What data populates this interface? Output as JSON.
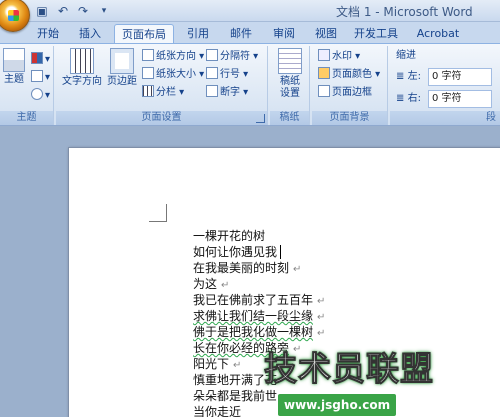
{
  "window": {
    "title": "文档 1 - Microsoft Word"
  },
  "quick_access": {
    "save_icon": "save-icon",
    "undo_icon": "undo-icon",
    "redo_icon": "redo-icon",
    "customize_icon": "customize-icon"
  },
  "tabs": [
    {
      "label": "开始"
    },
    {
      "label": "插入"
    },
    {
      "label": "页面布局",
      "active": true
    },
    {
      "label": "引用"
    },
    {
      "label": "邮件"
    },
    {
      "label": "审阅"
    },
    {
      "label": "视图"
    },
    {
      "label": "开发工具"
    },
    {
      "label": "Acrobat"
    }
  ],
  "ribbon": {
    "theme_group": {
      "label": "主题",
      "themes_button": "主题",
      "colors_icon": "theme-colors-icon",
      "fonts_icon": "theme-fonts-icon",
      "effects_icon": "theme-effects-icon"
    },
    "page_setup": {
      "label": "页面设置",
      "text_direction": "文字方向",
      "margins": "页边距",
      "orientation": "纸张方向",
      "size": "纸张大小",
      "columns": "分栏",
      "breaks": "分隔符",
      "line_numbers": "行号",
      "hyphenation": "断字"
    },
    "draft": {
      "label": "稿纸",
      "button": "稿纸\n设置"
    },
    "page_background": {
      "label": "页面背景",
      "watermark": "水印",
      "page_color": "页面颜色",
      "page_borders": "页面边框"
    },
    "paragraph": {
      "label": "段",
      "indent_title": "缩进",
      "left_label": "左:",
      "left_value": "0 字符",
      "right_label": "右:",
      "right_value": "0 字符"
    }
  },
  "document": {
    "lines": [
      "一棵开花的树",
      "如何让你遇见我",
      "在我最美丽的时刻",
      "为这",
      "我已在佛前求了五百年",
      "求佛让我们结一段尘缘",
      "佛于是把我化做一棵树",
      "长在你必经的路旁",
      "阳光下",
      "慎重地开满了花",
      "朵朵都是我前世",
      "当你走近"
    ],
    "paragraph_mark": "↵"
  },
  "watermark": {
    "logo_text": "技术员联盟",
    "url": "www.jsgho.com"
  }
}
